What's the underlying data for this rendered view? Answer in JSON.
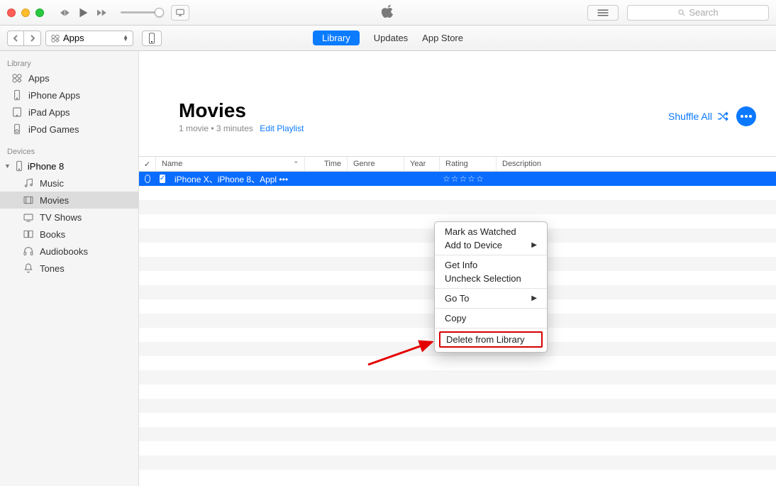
{
  "search": {
    "placeholder": "Search"
  },
  "navbar": {
    "media_selector": "Apps",
    "tabs": {
      "library": "Library",
      "updates": "Updates",
      "appstore": "App Store"
    }
  },
  "sidebar": {
    "library_label": "Library",
    "devices_label": "Devices",
    "library_items": {
      "apps": "Apps",
      "iphone_apps": "iPhone Apps",
      "ipad_apps": "iPad Apps",
      "ipod_games": "iPod Games"
    },
    "device_name": "iPhone 8",
    "device_children": {
      "music": "Music",
      "movies": "Movies",
      "tvshows": "TV Shows",
      "books": "Books",
      "audiobooks": "Audiobooks",
      "tones": "Tones"
    }
  },
  "header": {
    "title": "Movies",
    "subtitle": "1 movie • 3 minutes",
    "edit_link": "Edit Playlist",
    "shuffle": "Shuffle All"
  },
  "columns": {
    "check": "✓",
    "name": "Name",
    "time": "Time",
    "genre": "Genre",
    "year": "Year",
    "rating": "Rating",
    "description": "Description"
  },
  "rows": [
    {
      "name": "iPhone X、iPhone 8、Appl •••",
      "rating": "☆☆☆☆☆"
    }
  ],
  "context_menu": {
    "mark_watched": "Mark as Watched",
    "add_to_device": "Add to Device",
    "get_info": "Get Info",
    "uncheck": "Uncheck Selection",
    "goto": "Go To",
    "copy": "Copy",
    "delete": "Delete from Library"
  }
}
